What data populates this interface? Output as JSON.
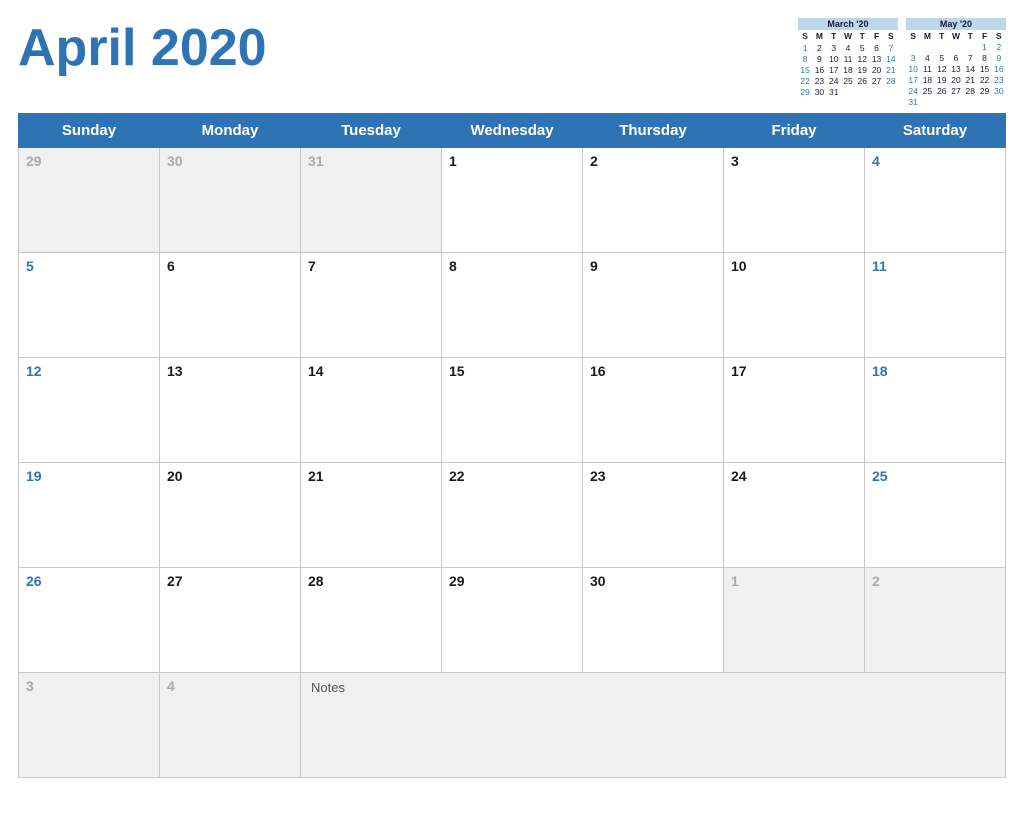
{
  "header": {
    "title": "April 2020"
  },
  "mini_calendars": [
    {
      "title": "March '20",
      "days_header": [
        "S",
        "M",
        "T",
        "W",
        "T",
        "F",
        "S"
      ],
      "weeks": [
        [
          "",
          "",
          "",
          "",
          "",
          "",
          ""
        ],
        [
          "1",
          "2",
          "3",
          "4",
          "5",
          "6",
          "7"
        ],
        [
          "8",
          "9",
          "10",
          "11",
          "12",
          "13",
          "14"
        ],
        [
          "15",
          "16",
          "17",
          "18",
          "19",
          "20",
          "21"
        ],
        [
          "22",
          "23",
          "24",
          "25",
          "26",
          "27",
          "28"
        ],
        [
          "29",
          "30",
          "31",
          "",
          "",
          "",
          ""
        ]
      ],
      "weekend_cols": [
        0,
        6
      ]
    },
    {
      "title": "May '20",
      "days_header": [
        "S",
        "M",
        "T",
        "W",
        "T",
        "F",
        "S"
      ],
      "weeks": [
        [
          "",
          "",
          "",
          "",
          "",
          "1",
          "2"
        ],
        [
          "3",
          "4",
          "5",
          "6",
          "7",
          "8",
          "9"
        ],
        [
          "10",
          "11",
          "12",
          "13",
          "14",
          "15",
          "16"
        ],
        [
          "17",
          "18",
          "19",
          "20",
          "21",
          "22",
          "23"
        ],
        [
          "24",
          "25",
          "26",
          "27",
          "28",
          "29",
          "30"
        ],
        [
          "31",
          "",
          "",
          "",
          "",
          "",
          ""
        ]
      ],
      "weekend_cols": [
        0,
        6
      ]
    }
  ],
  "weekday_headers": [
    "Sunday",
    "Monday",
    "Tuesday",
    "Wednesday",
    "Thursday",
    "Friday",
    "Saturday"
  ],
  "weeks": [
    [
      {
        "num": "29",
        "type": "out"
      },
      {
        "num": "30",
        "type": "out"
      },
      {
        "num": "31",
        "type": "out"
      },
      {
        "num": "1",
        "type": "normal"
      },
      {
        "num": "2",
        "type": "normal"
      },
      {
        "num": "3",
        "type": "normal"
      },
      {
        "num": "4",
        "type": "weekend"
      }
    ],
    [
      {
        "num": "5",
        "type": "weekend"
      },
      {
        "num": "6",
        "type": "normal"
      },
      {
        "num": "7",
        "type": "normal"
      },
      {
        "num": "8",
        "type": "normal"
      },
      {
        "num": "9",
        "type": "normal"
      },
      {
        "num": "10",
        "type": "normal"
      },
      {
        "num": "11",
        "type": "weekend"
      }
    ],
    [
      {
        "num": "12",
        "type": "weekend"
      },
      {
        "num": "13",
        "type": "normal"
      },
      {
        "num": "14",
        "type": "normal"
      },
      {
        "num": "15",
        "type": "normal"
      },
      {
        "num": "16",
        "type": "normal"
      },
      {
        "num": "17",
        "type": "normal"
      },
      {
        "num": "18",
        "type": "weekend"
      }
    ],
    [
      {
        "num": "19",
        "type": "weekend"
      },
      {
        "num": "20",
        "type": "normal"
      },
      {
        "num": "21",
        "type": "normal"
      },
      {
        "num": "22",
        "type": "normal"
      },
      {
        "num": "23",
        "type": "normal"
      },
      {
        "num": "24",
        "type": "normal"
      },
      {
        "num": "25",
        "type": "weekend"
      }
    ],
    [
      {
        "num": "26",
        "type": "weekend"
      },
      {
        "num": "27",
        "type": "normal"
      },
      {
        "num": "28",
        "type": "normal"
      },
      {
        "num": "29",
        "type": "normal"
      },
      {
        "num": "30",
        "type": "normal"
      },
      {
        "num": "1",
        "type": "out"
      },
      {
        "num": "2",
        "type": "out"
      }
    ]
  ],
  "last_row": [
    {
      "num": "3",
      "type": "out"
    },
    {
      "num": "4",
      "type": "out"
    }
  ],
  "notes_label": "Notes",
  "colors": {
    "accent": "#2E74B5",
    "mini_cal_bg": "#BDD7EE",
    "weekend_text": "#2E74B5",
    "out_month_bg": "#f0f0f0",
    "out_month_text": "#aaa"
  }
}
